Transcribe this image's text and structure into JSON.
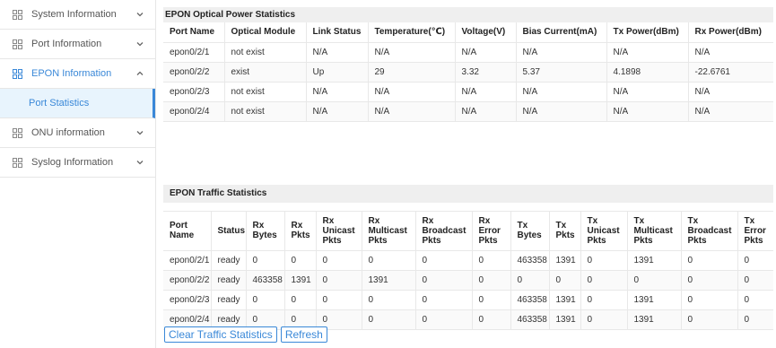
{
  "sidebar": {
    "items": [
      {
        "label": "System Information",
        "expanded": false
      },
      {
        "label": "Port Information",
        "expanded": false
      },
      {
        "label": "EPON Information",
        "expanded": true,
        "sub": "Port Statistics"
      },
      {
        "label": "ONU information",
        "expanded": false
      },
      {
        "label": "Syslog Information",
        "expanded": false
      }
    ]
  },
  "optical": {
    "title": "EPON Optical Power Statistics",
    "headers": [
      "Port Name",
      "Optical Module",
      "Link Status",
      "Temperature(℃)",
      "Voltage(V)",
      "Bias Current(mA)",
      "Tx Power(dBm)",
      "Rx Power(dBm)"
    ],
    "rows": [
      [
        "epon0/2/1",
        "not exist",
        "N/A",
        "N/A",
        "N/A",
        "N/A",
        "N/A",
        "N/A"
      ],
      [
        "epon0/2/2",
        "exist",
        "Up",
        "29",
        "3.32",
        "5.37",
        "4.1898",
        "-22.6761"
      ],
      [
        "epon0/2/3",
        "not exist",
        "N/A",
        "N/A",
        "N/A",
        "N/A",
        "N/A",
        "N/A"
      ],
      [
        "epon0/2/4",
        "not exist",
        "N/A",
        "N/A",
        "N/A",
        "N/A",
        "N/A",
        "N/A"
      ]
    ]
  },
  "traffic": {
    "title": "EPON Traffic Statistics",
    "headers": [
      "Port Name",
      "Status",
      "Rx Bytes",
      "Rx Pkts",
      "Rx Unicast Pkts",
      "Rx Multicast Pkts",
      "Rx Broadcast Pkts",
      "Rx Error Pkts",
      "Tx Bytes",
      "Tx Pkts",
      "Tx Unicast Pkts",
      "Tx Multicast Pkts",
      "Tx Broadcast Pkts",
      "Tx Error Pkts"
    ],
    "rows": [
      [
        "epon0/2/1",
        "ready",
        "0",
        "0",
        "0",
        "0",
        "0",
        "0",
        "463358",
        "1391",
        "0",
        "1391",
        "0",
        "0"
      ],
      [
        "epon0/2/2",
        "ready",
        "463358",
        "1391",
        "0",
        "1391",
        "0",
        "0",
        "0",
        "0",
        "0",
        "0",
        "0",
        "0"
      ],
      [
        "epon0/2/3",
        "ready",
        "0",
        "0",
        "0",
        "0",
        "0",
        "0",
        "463358",
        "1391",
        "0",
        "1391",
        "0",
        "0"
      ],
      [
        "epon0/2/4",
        "ready",
        "0",
        "0",
        "0",
        "0",
        "0",
        "0",
        "463358",
        "1391",
        "0",
        "1391",
        "0",
        "0"
      ]
    ]
  },
  "buttons": {
    "clear": "Clear Traffic Statistics",
    "refresh": "Refresh"
  }
}
